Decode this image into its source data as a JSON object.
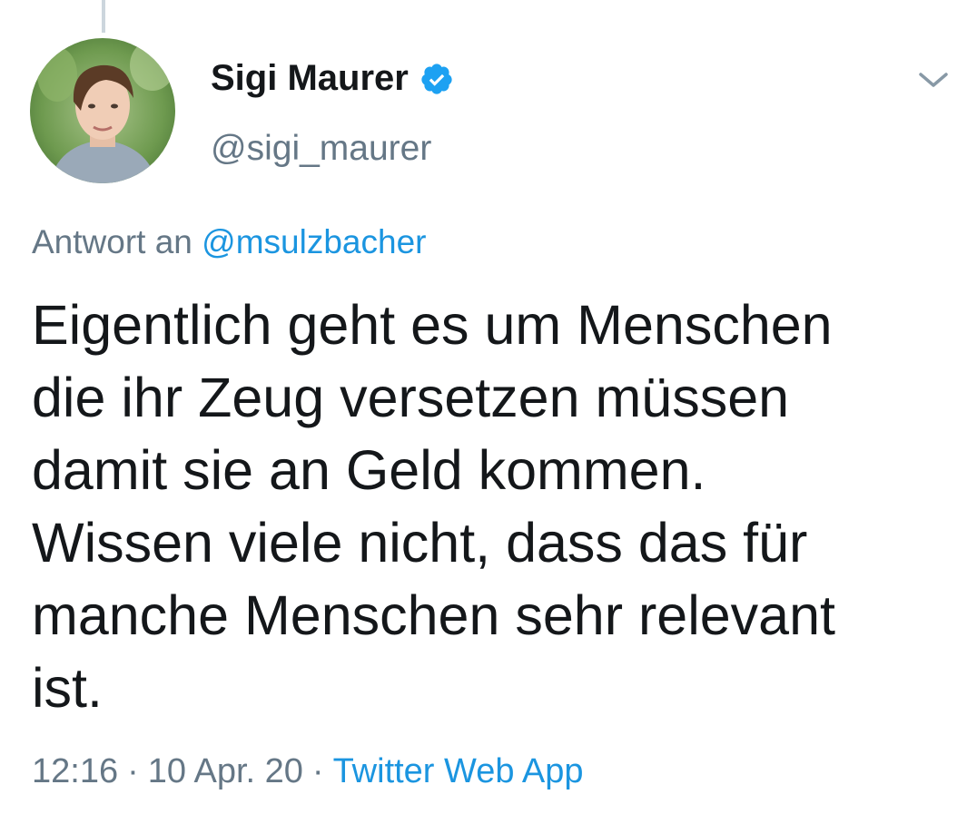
{
  "tweet": {
    "author": {
      "name": "Sigi Maurer",
      "handle": "@sigi_maurer",
      "verified": true
    },
    "reply": {
      "prefix": "Antwort an",
      "mention": "@msulzbacher"
    },
    "text": "Eigentlich geht es um Menschen\ndie ihr Zeug versetzen müssen\ndamit sie an Geld kommen.\nWissen viele nicht, dass das für\nmanche Menschen sehr relevant\nist.",
    "time": "12:16",
    "date": "10 Apr. 20",
    "separator": "·",
    "source": "Twitter Web App"
  },
  "icons": {
    "verified": "verified-badge-icon",
    "menu": "chevron-down-icon"
  },
  "colors": {
    "accent": "#1b95e0",
    "text": "#14171a",
    "secondary": "#657786",
    "thread_line": "#ccd6dd"
  }
}
